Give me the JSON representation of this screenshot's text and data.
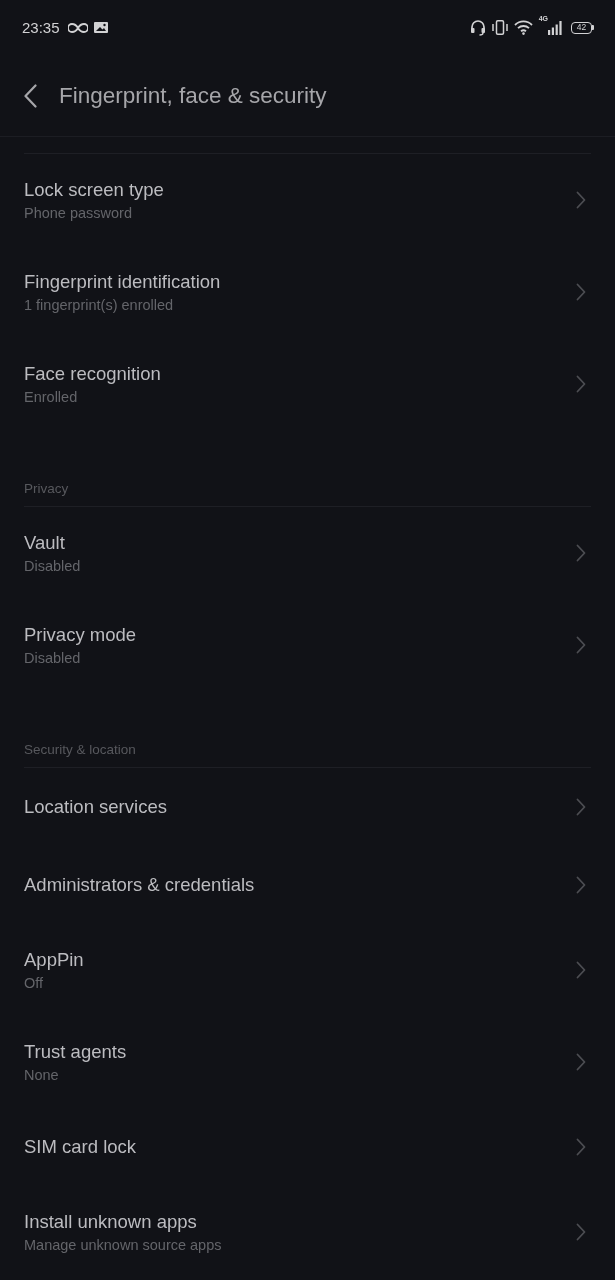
{
  "status_bar": {
    "time": "23:35",
    "network_type": "4G",
    "battery": "42"
  },
  "header": {
    "title": "Fingerprint, face & security"
  },
  "sections": [
    {
      "items": [
        {
          "title": "Lock screen type",
          "subtitle": "Phone password"
        },
        {
          "title": "Fingerprint identification",
          "subtitle": "1 fingerprint(s) enrolled"
        },
        {
          "title": "Face recognition",
          "subtitle": "Enrolled"
        }
      ]
    },
    {
      "heading": "Privacy",
      "items": [
        {
          "title": "Vault",
          "subtitle": "Disabled"
        },
        {
          "title": "Privacy mode",
          "subtitle": "Disabled"
        }
      ]
    },
    {
      "heading": "Security & location",
      "items": [
        {
          "title": "Location services"
        },
        {
          "title": "Administrators & credentials"
        },
        {
          "title": "AppPin",
          "subtitle": "Off"
        },
        {
          "title": "Trust agents",
          "subtitle": "None"
        },
        {
          "title": "SIM card lock"
        },
        {
          "title": "Install unknown apps",
          "subtitle": "Manage unknown source apps"
        }
      ]
    }
  ]
}
